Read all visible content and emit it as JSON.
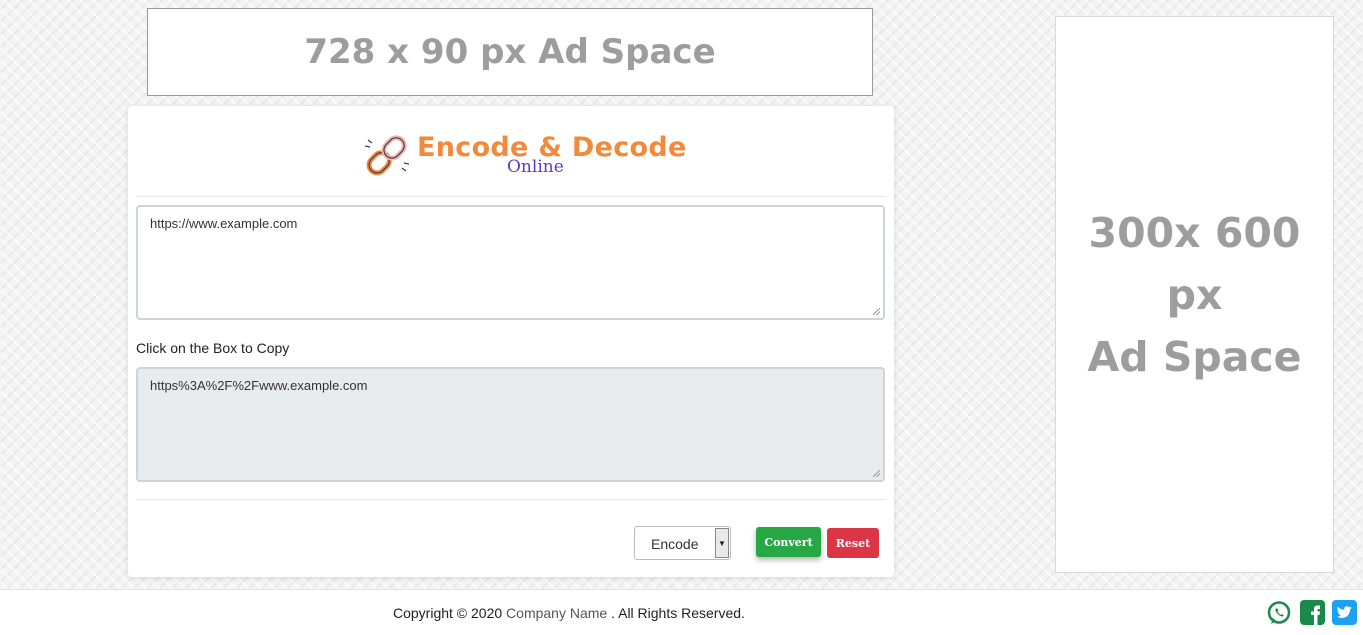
{
  "ads": {
    "top": "728 x 90 px Ad Space",
    "side_line1": "300x 600 px",
    "side_line2": "Ad Space"
  },
  "logo": {
    "title": "Encode & Decode",
    "subtitle": "Online",
    "icon": "chain-link-icon"
  },
  "input": {
    "value": "https://www.example.com"
  },
  "output": {
    "label": "Click on the Box to Copy",
    "value": "https%3A%2F%2Fwww.example.com"
  },
  "controls": {
    "mode_selected": "Encode",
    "convert_label": "Convert",
    "reset_label": "Reset"
  },
  "footer": {
    "copyright_prefix": "Copyright © 2020",
    "company": "Company Name",
    "suffix": ". All Rights Reserved.",
    "social": [
      "whatsapp-icon",
      "facebook-icon",
      "twitter-icon"
    ]
  },
  "colors": {
    "brand_orange": "#f28a3c",
    "brand_purple": "#5b3cc4",
    "convert_green": "#28a745",
    "reset_red": "#dc3545",
    "social_green": "#1a8a4a",
    "twitter_blue": "#1da1f2"
  }
}
